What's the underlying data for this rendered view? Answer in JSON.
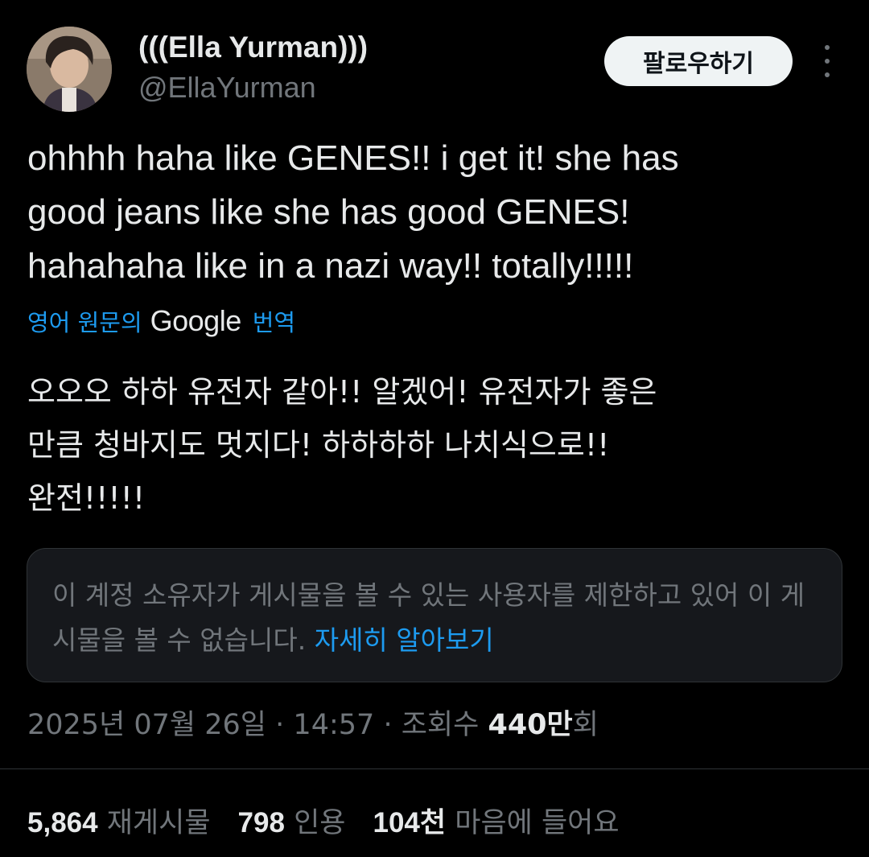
{
  "author": {
    "display_name": "(((Ella Yurman)))",
    "handle": "@EllaYurman",
    "avatar_icon": "profile-photo"
  },
  "header": {
    "follow_label": "팔로우하기",
    "more_icon": "more-vertical-icon"
  },
  "tweet": {
    "text": "ohhhh haha like GENES!! i get it! she has\ngood jeans like she has good GENES!\nhahahaha like in a nazi way!! totally!!!!!",
    "translation_prefix": "영어 원문의",
    "translation_brand": "Google",
    "translation_suffix": "번역",
    "translated_text": "오오오 하하 유전자 같아!! 알겠어! 유전자가 좋은\n만큼 청바지도 멋지다! 하하하하 나치식으로!!\n완전!!!!!"
  },
  "restriction": {
    "text": "이 계정 소유자가 게시물을 볼 수 있는 사용자를 제한하고 있어 이 게시물을 볼 수 없습니다.",
    "link": "자세히 알아보기"
  },
  "meta": {
    "date": "2025년 07월 26일",
    "separator": "·",
    "time": "14:57",
    "views_label": "조회수",
    "views_count": "440만",
    "views_suffix": "회"
  },
  "stats": {
    "reposts_count": "5,864",
    "reposts_label": "재게시물",
    "quotes_count": "798",
    "quotes_label": "인용",
    "likes_count": "104천",
    "likes_label": "마음에 들어요"
  },
  "colors": {
    "background": "#000000",
    "text_primary": "#e7e9ea",
    "text_secondary": "#71767b",
    "accent": "#1d9bf0",
    "button_bg": "#eff3f4"
  }
}
